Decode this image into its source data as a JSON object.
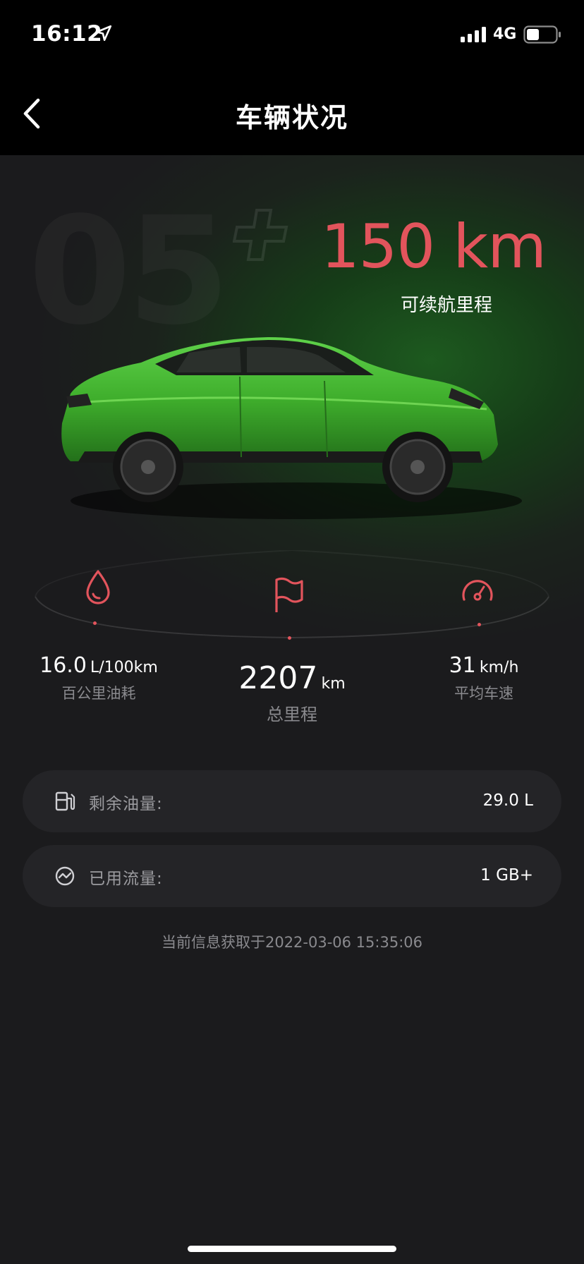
{
  "status_bar": {
    "time": "16:12",
    "network": "4G"
  },
  "nav": {
    "title": "车辆状况"
  },
  "hero": {
    "watermark": "05",
    "range_value": "150 km",
    "range_label": "可续航里程",
    "car_color": "#3fae2c"
  },
  "stats": {
    "fuel_consumption": {
      "value": "16.0",
      "unit": "L/100km",
      "label": "百公里油耗"
    },
    "total_mileage": {
      "value": "2207",
      "unit": "km",
      "label": "总里程"
    },
    "avg_speed": {
      "value": "31",
      "unit": "km/h",
      "label": "平均车速"
    }
  },
  "cards": {
    "fuel_remaining": {
      "label": "剩余油量:",
      "value": "29.0 L"
    },
    "data_used": {
      "label": "已用流量:",
      "value": "1 GB+"
    }
  },
  "updated_text": "当前信息获取于2022-03-06 15:35:06",
  "colors": {
    "accent": "#e2545c",
    "background": "#1b1b1d",
    "card": "#242427"
  }
}
